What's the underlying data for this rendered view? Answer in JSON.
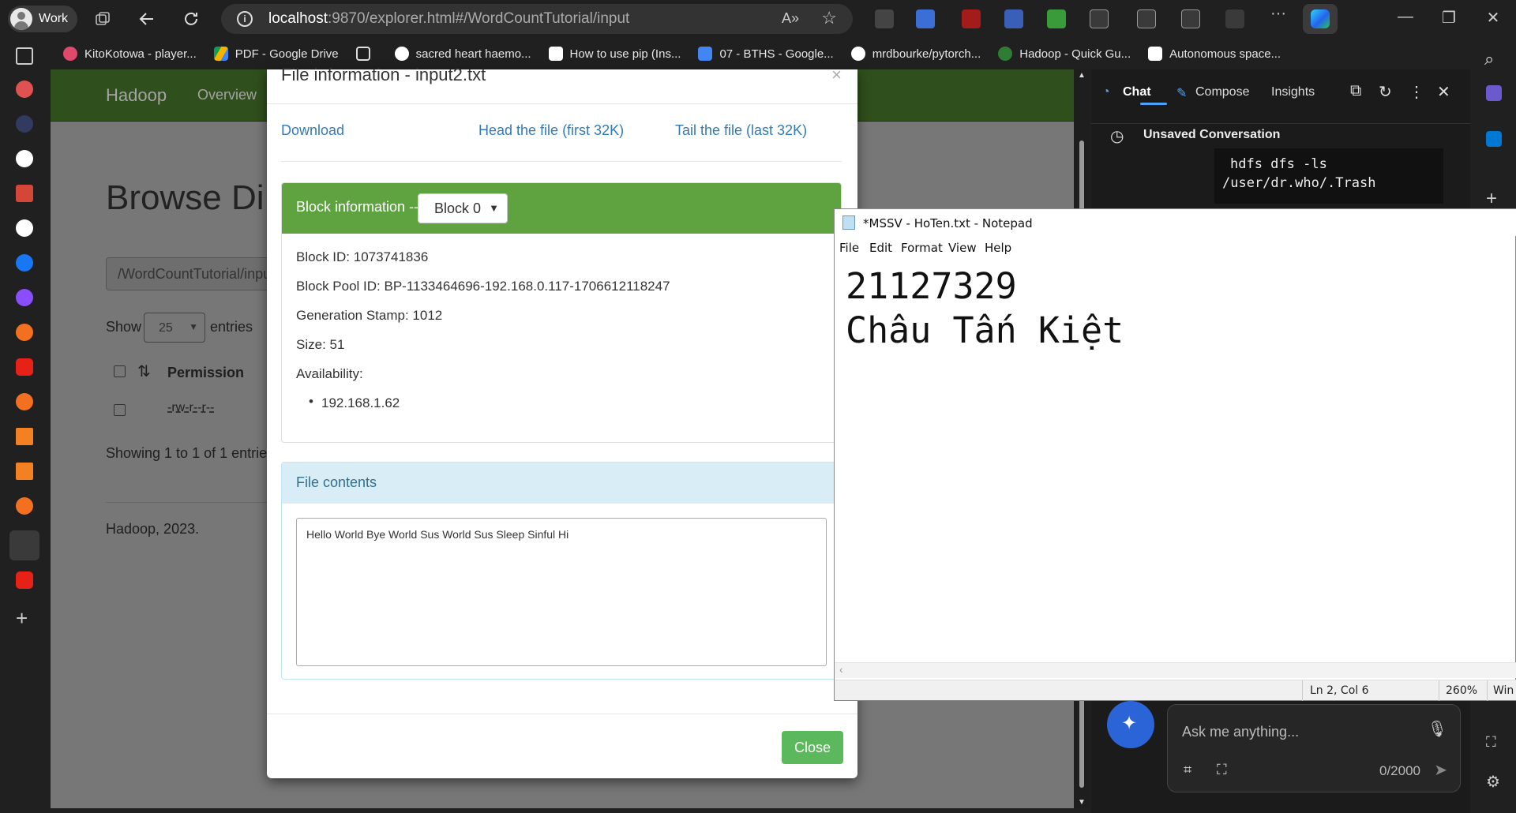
{
  "browser": {
    "profile_label": "Work",
    "url_host": "localhost",
    "url_path": ":9870/explorer.html#/WordCountTutorial/input"
  },
  "bookmarks": [
    {
      "label": "KitoKotowa - player...",
      "color": "#e0486c"
    },
    {
      "label": "PDF - Google Drive",
      "color": "#f4b400"
    },
    {
      "label": "sacred heart haemo...",
      "color": "#ffffff"
    },
    {
      "label": "How to use pip (Ins...",
      "color": "#ffffff"
    },
    {
      "label": "07 - BTHS - Google...",
      "color": "#4285f4"
    },
    {
      "label": "mrdbourke/pytorch...",
      "color": "#ffffff"
    },
    {
      "label": "Hadoop - Quick Gu...",
      "color": "#2e7d32"
    },
    {
      "label": "Autonomous space...",
      "color": "#ffffff"
    }
  ],
  "hadoop_page": {
    "brand": "Hadoop",
    "nav_overview": "Overview",
    "title": "Browse Di",
    "path_value": "/WordCountTutorial/inpu",
    "show_label": "Show",
    "entries_value": "25",
    "entries_label": "entries",
    "col_permission": "Permission",
    "row_permission": "-rw-r--r--",
    "showing_text": "Showing 1 to 1 of 1 entries",
    "footer": "Hadoop, 2023."
  },
  "modal": {
    "title": "File information - input2.txt",
    "close_x": "×",
    "download": "Download",
    "head_link": "Head the file (first 32K)",
    "tail_link": "Tail the file (last 32K)",
    "block_info_label": "Block information --",
    "block_selected": "Block 0",
    "block_id": "Block ID: 1073741836",
    "block_pool_id": "Block Pool ID: BP-1133464696-192.168.0.117-1706612118247",
    "generation_stamp": "Generation Stamp: 1012",
    "size": "Size: 51",
    "availability_label": "Availability:",
    "availability_hosts": [
      "192.168.1.62"
    ],
    "file_contents_label": "File contents",
    "file_contents": "Hello World Bye World Sus World Sus Sleep Sinful Hi",
    "close_button": "Close"
  },
  "copilot": {
    "tab_chat": "Chat",
    "tab_compose": "Compose",
    "tab_insights": "Insights",
    "conversation_title": "Unsaved Conversation",
    "code_line1": "hdfs dfs -ls",
    "code_line2": "/user/dr.who/.Trash",
    "ask_placeholder": "Ask me anything...",
    "char_count": "0/2000",
    "accent": "#4ea3ff"
  },
  "notepad": {
    "title": "*MSSV - HoTen.txt - Notepad",
    "menu": [
      "File",
      "Edit",
      "Format",
      "View",
      "Help"
    ],
    "line1": "21127329",
    "line2": "Châu Tấn Kiệt",
    "status_position": "Ln 2, Col 6",
    "status_zoom": "260%",
    "status_eol": "Win"
  }
}
